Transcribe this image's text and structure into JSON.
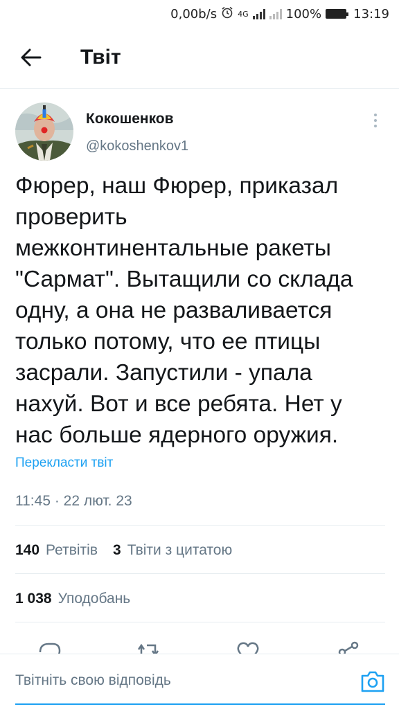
{
  "status_bar": {
    "net_speed": "0,00b/s",
    "network_type": "4G",
    "battery": "100%",
    "time": "13:19",
    "icons": [
      "alarm-icon",
      "signal-icon",
      "signal-icon",
      "battery-icon"
    ]
  },
  "header": {
    "title": "Твіт",
    "back_icon": "arrow-left-icon"
  },
  "tweet": {
    "display_name": "Кокошенков",
    "handle": "@kokoshenkov1",
    "text": "Фюрер, наш Фюрер, приказал\nпроверить\nмежконтинентальные ракеты\n\"Сармат\". Вытащили со склада\nодну, а она не разваливается\nтолько потому, что ее птицы\nзасрали. Запустили - упала\nнахуй. Вот и все ребята. Нет у\nнас больше ядерного оружия.",
    "translate_link": "Перекласти твіт",
    "timestamp": "11:45 · 22 лют. 23"
  },
  "stats": {
    "retweets_count": "140",
    "retweets_label": "Ретвітів",
    "quotes_count": "3",
    "quotes_label": "Твіти з цитатою",
    "likes_count": "1 038",
    "likes_label": "Уподобань"
  },
  "actions": [
    "reply-icon",
    "retweet-icon",
    "like-icon",
    "share-icon"
  ],
  "reply": {
    "placeholder": "Твітніть свою відповідь",
    "camera_icon": "camera-icon"
  },
  "colors": {
    "accent": "#1da1f2",
    "secondary_text": "#657786",
    "primary_text": "#14171a",
    "divider": "#e6ecf0"
  }
}
